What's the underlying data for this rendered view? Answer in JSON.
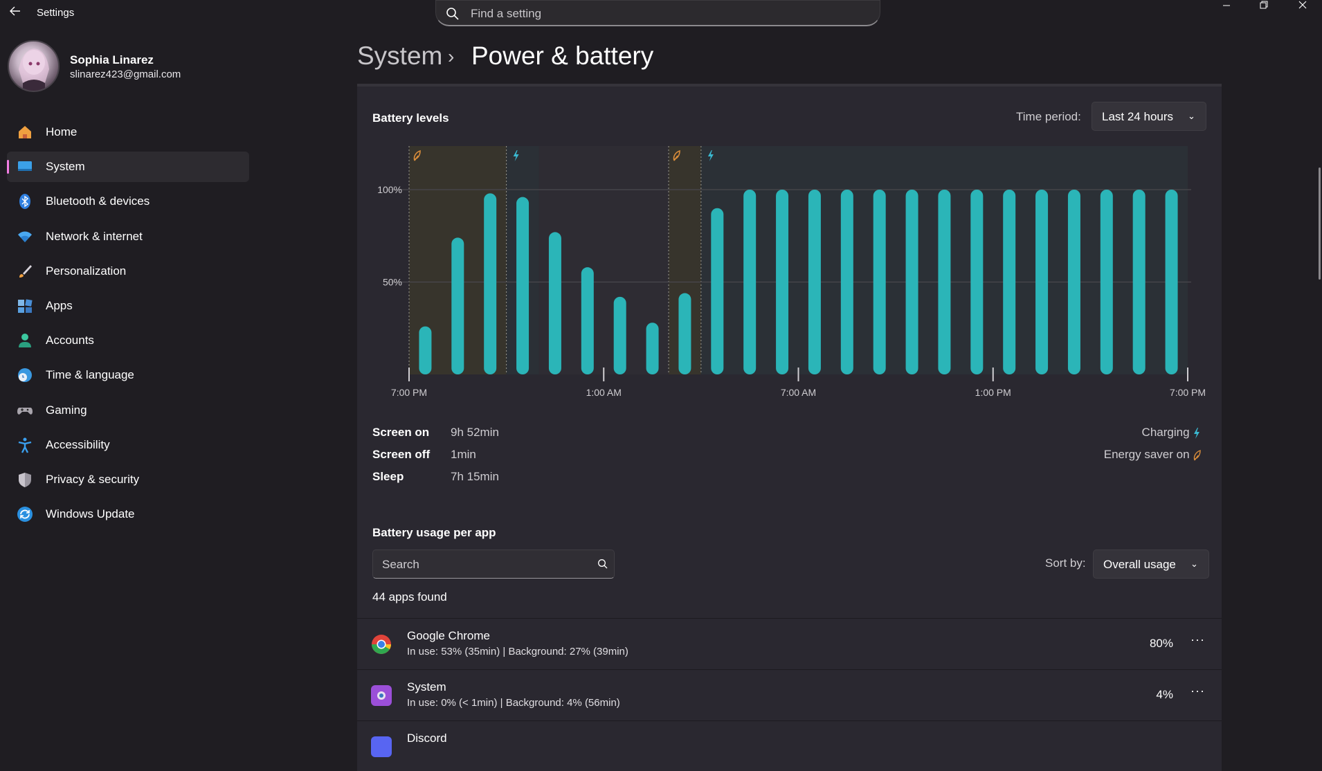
{
  "window": {
    "app_title": "Settings",
    "search_placeholder": "Find a setting",
    "back_icon": "back-arrow-icon",
    "controls": [
      "minimize-icon",
      "restore-icon",
      "close-icon"
    ]
  },
  "profile": {
    "name": "Sophia Linarez",
    "email": "slinarez423@gmail.com"
  },
  "sidebar": {
    "items": [
      {
        "label": "Home",
        "icon": "home-icon",
        "active": false
      },
      {
        "label": "System",
        "icon": "system-icon",
        "active": true
      },
      {
        "label": "Bluetooth & devices",
        "icon": "bluetooth-icon",
        "active": false
      },
      {
        "label": "Network & internet",
        "icon": "wifi-icon",
        "active": false
      },
      {
        "label": "Personalization",
        "icon": "brush-icon",
        "active": false
      },
      {
        "label": "Apps",
        "icon": "apps-icon",
        "active": false
      },
      {
        "label": "Accounts",
        "icon": "person-icon",
        "active": false
      },
      {
        "label": "Time & language",
        "icon": "globe-clock-icon",
        "active": false
      },
      {
        "label": "Gaming",
        "icon": "gamepad-icon",
        "active": false
      },
      {
        "label": "Accessibility",
        "icon": "accessibility-icon",
        "active": false
      },
      {
        "label": "Privacy & security",
        "icon": "shield-icon",
        "active": false
      },
      {
        "label": "Windows Update",
        "icon": "update-icon",
        "active": false
      }
    ]
  },
  "header": {
    "breadcrumb_parent": "System",
    "breadcrumb_separator": "›",
    "page_title": "Power & battery"
  },
  "battery_levels": {
    "title": "Battery levels",
    "time_period_label": "Time period:",
    "time_period_value": "Last 24 hours",
    "stats": [
      {
        "label": "Screen on",
        "value": "9h 52min"
      },
      {
        "label": "Screen off",
        "value": "1min"
      },
      {
        "label": "Sleep",
        "value": "7h 15min"
      }
    ],
    "legend": [
      {
        "label": "Charging",
        "icon": "lightning-icon",
        "color": "#3ab8d0"
      },
      {
        "label": "Energy saver on",
        "icon": "leaf-icon",
        "color": "#d98c3a"
      }
    ]
  },
  "chart_data": {
    "type": "bar",
    "y_tick_labels": [
      "100%",
      "50%"
    ],
    "y_ticks": [
      100,
      50
    ],
    "ylim": [
      0,
      100
    ],
    "x_tick_labels": [
      "7:00 PM",
      "1:00 AM",
      "7:00 AM",
      "1:00 PM",
      "7:00 PM"
    ],
    "x_ticks_hours": [
      0,
      6,
      12,
      18,
      24
    ],
    "bar_hours": [
      0.5,
      1.5,
      2.5,
      3.5,
      4.5,
      5.5,
      6.5,
      7.5,
      8.5,
      9.5,
      10.5,
      11.5,
      12.5,
      13.5,
      14.5,
      15.5,
      16.5,
      17.5,
      18.5,
      19.5,
      20.5,
      21.5,
      22.5,
      23.5
    ],
    "values": [
      26,
      74,
      98,
      96,
      77,
      58,
      42,
      28,
      44,
      90,
      100,
      100,
      100,
      100,
      100,
      100,
      100,
      100,
      100,
      100,
      100,
      100,
      100,
      100
    ],
    "bar_color": "#2bb5b8",
    "energy_saver_periods_hours": [
      [
        0,
        3
      ],
      [
        8,
        9
      ]
    ],
    "charging_periods_hours": [
      [
        3,
        4
      ],
      [
        9,
        24
      ]
    ],
    "energy_saver_color": "#d98c3a",
    "charging_color": "#3ab8d0",
    "grid": true
  },
  "usage": {
    "title": "Battery usage per app",
    "search_placeholder": "Search",
    "sort_label": "Sort by:",
    "sort_value": "Overall usage",
    "apps_found": "44 apps found",
    "apps": [
      {
        "name": "Google Chrome",
        "detail": "In use: 53% (35min) | Background: 27% (39min)",
        "percent": "80%",
        "icon": "chrome-icon"
      },
      {
        "name": "System",
        "detail": "In use: 0% (< 1min) | Background: 4% (56min)",
        "percent": "4%",
        "icon": "system-app-icon"
      },
      {
        "name": "Discord",
        "detail": "",
        "percent": "",
        "icon": "discord-icon"
      }
    ],
    "more_label": "···"
  }
}
